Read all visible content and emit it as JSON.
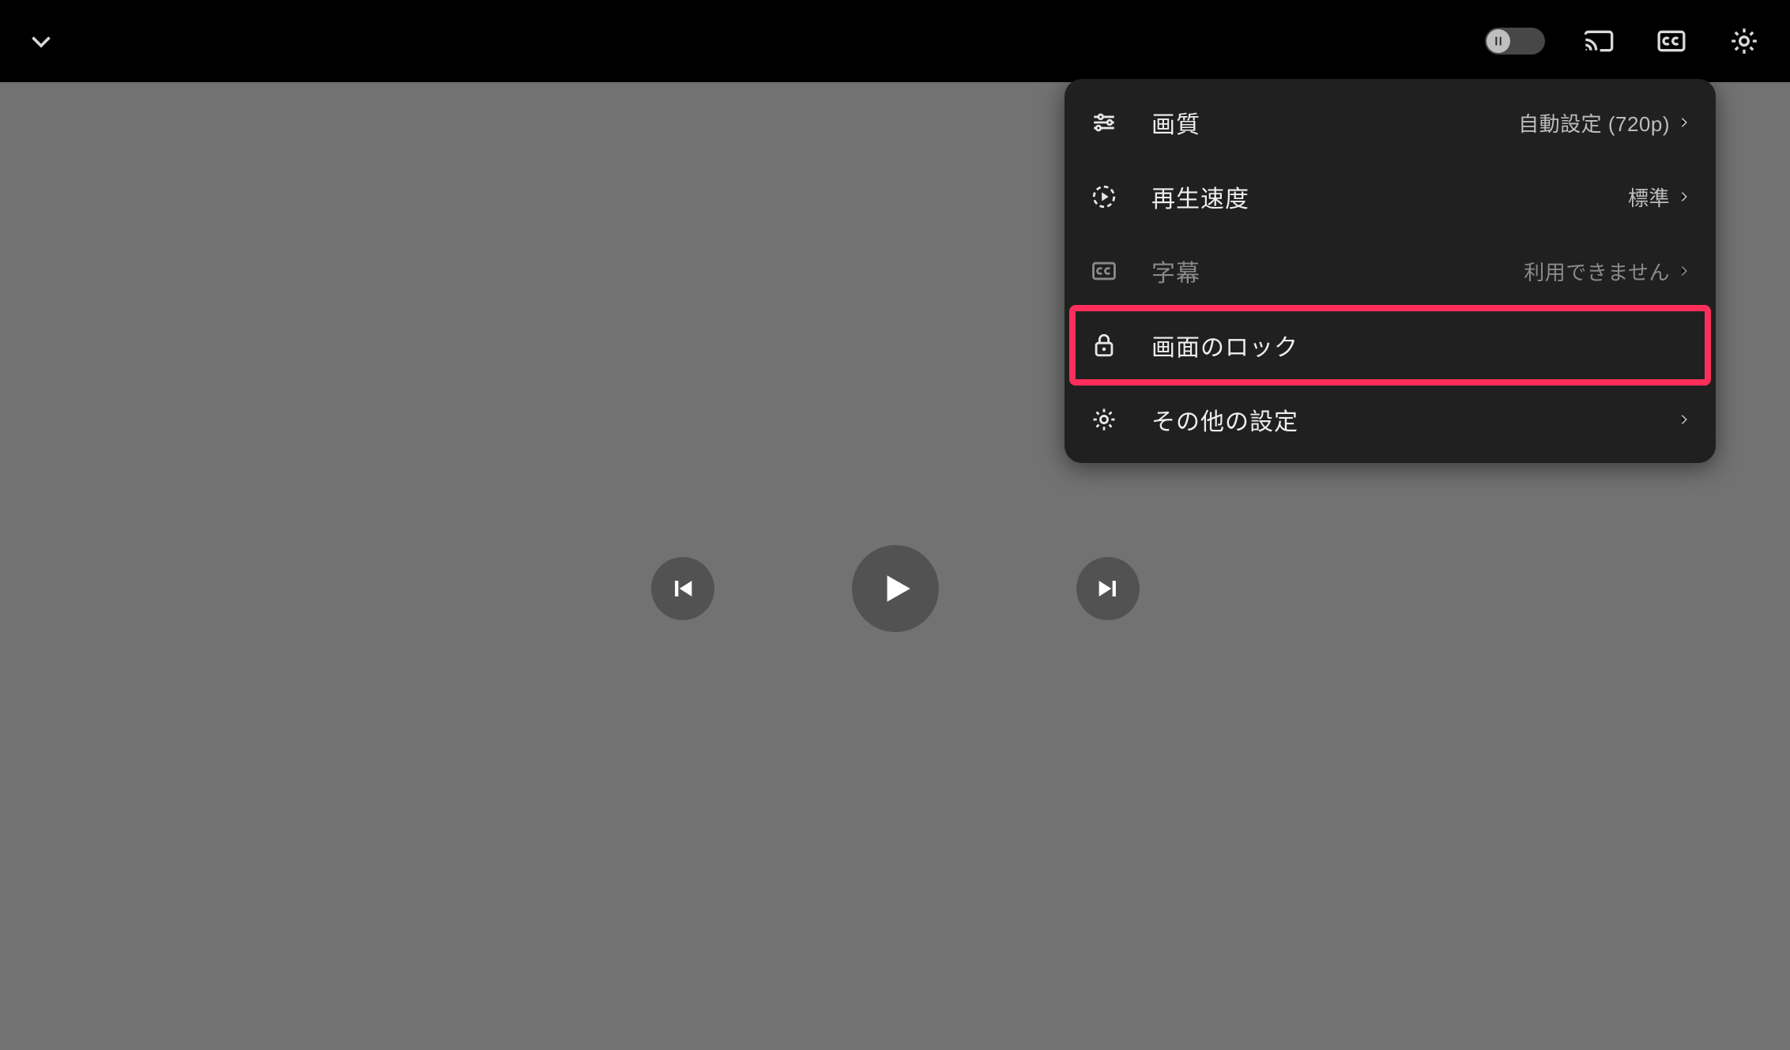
{
  "topbar": {
    "toggle_icon": "pause-icon"
  },
  "settings_menu": {
    "quality": {
      "label": "画質",
      "value": "自動設定 (720p)"
    },
    "speed": {
      "label": "再生速度",
      "value": "標準"
    },
    "subtitles": {
      "label": "字幕",
      "value": "利用できません"
    },
    "screen_lock": {
      "label": "画面のロック"
    },
    "more": {
      "label": "その他の設定"
    }
  }
}
